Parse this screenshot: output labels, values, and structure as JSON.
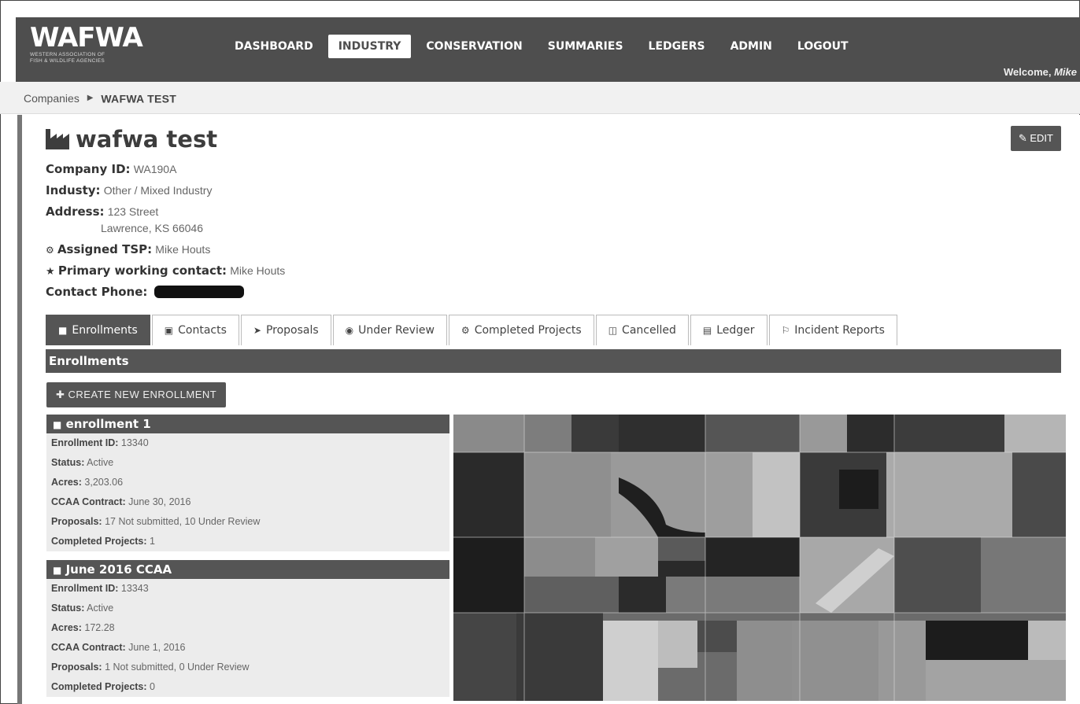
{
  "header": {
    "logo_title": "WAFWA",
    "logo_sub_1": "WESTERN ASSOCIATION OF",
    "logo_sub_2": "FISH & WILDLIFE AGENCIES",
    "nav": [
      "DASHBOARD",
      "INDUSTRY",
      "CONSERVATION",
      "SUMMARIES",
      "LEDGERS",
      "ADMIN",
      "LOGOUT"
    ],
    "active_nav": "INDUSTRY",
    "welcome_label": "Welcome,",
    "welcome_user": "Mike"
  },
  "breadcrumb": {
    "root": "Companies",
    "current": "WAFWA TEST"
  },
  "company": {
    "name": "wafwa test",
    "edit_label": "EDIT",
    "id_label": "Company ID:",
    "id_value": "WA190A",
    "industry_label": "Industy:",
    "industry_value": "Other / Mixed Industry",
    "address_label": "Address:",
    "address_line1": "123 Street",
    "address_line2": "Lawrence, KS 66046",
    "tsp_label": "Assigned TSP:",
    "tsp_value": "Mike Houts",
    "contact_label": "Primary working contact:",
    "contact_value": "Mike Houts",
    "phone_label": "Contact Phone:"
  },
  "tabs": [
    {
      "label": "Enrollments",
      "icon": "graduation-cap-icon"
    },
    {
      "label": "Contacts",
      "icon": "contacts-icon"
    },
    {
      "label": "Proposals",
      "icon": "send-icon"
    },
    {
      "label": "Under Review",
      "icon": "eye-icon"
    },
    {
      "label": "Completed Projects",
      "icon": "tractor-icon"
    },
    {
      "label": "Cancelled",
      "icon": "trash-icon"
    },
    {
      "label": "Ledger",
      "icon": "ledger-icon"
    },
    {
      "label": "Incident Reports",
      "icon": "report-icon"
    }
  ],
  "section_title": "Enrollments",
  "create_button": "CREATE NEW ENROLLMENT",
  "enrollments": [
    {
      "name": "enrollment 1",
      "id_label": "Enrollment ID:",
      "id": "13340",
      "status_label": "Status:",
      "status": "Active",
      "acres_label": "Acres:",
      "acres": "3,203.06",
      "contract_label": "CCAA Contract:",
      "contract": "June 30, 2016",
      "proposals_label": "Proposals:",
      "proposals": "17 Not submitted, 10 Under Review",
      "completed_label": "Completed Projects:",
      "completed": "1"
    },
    {
      "name": "June 2016 CCAA",
      "id_label": "Enrollment ID:",
      "id": "13343",
      "status_label": "Status:",
      "status": "Active",
      "acres_label": "Acres:",
      "acres": "172.28",
      "contract_label": "CCAA Contract:",
      "contract": "June 1, 2016",
      "proposals_label": "Proposals:",
      "proposals": "1 Not submitted, 0 Under Review",
      "completed_label": "Completed Projects:",
      "completed": "0"
    }
  ],
  "colors": {
    "navbar": "#4e4e4e",
    "header_bar": "#555555",
    "panel_bg": "#ececec"
  }
}
